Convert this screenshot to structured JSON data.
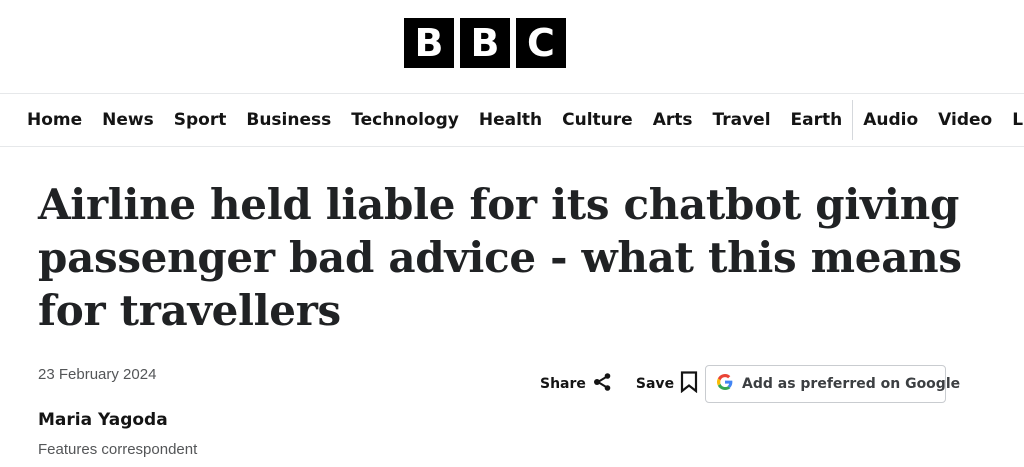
{
  "brand": {
    "letters": [
      "B",
      "B",
      "C"
    ]
  },
  "nav": {
    "items": [
      "Home",
      "News",
      "Sport",
      "Business",
      "Technology",
      "Health",
      "Culture",
      "Arts",
      "Travel",
      "Earth"
    ],
    "media_items": [
      "Audio",
      "Video",
      "Live"
    ]
  },
  "article": {
    "headline": "Airline held liable for its chatbot giving passenger bad advice - what this means for travellers",
    "date": "23 February 2024",
    "author": "Maria Yagoda",
    "role": "Features correspondent"
  },
  "actions": {
    "share_label": "Share",
    "share_icon": "share-icon",
    "save_label": "Save",
    "save_icon": "bookmark-icon",
    "google_label": "Add as preferred on Google",
    "google_icon": "google-g-icon"
  },
  "colors": {
    "text": "#141414",
    "muted": "#545658",
    "logo_bg": "#000000",
    "google_blue": "#4285F4",
    "google_red": "#EA4335",
    "google_yellow": "#FBBC05",
    "google_green": "#34A853"
  }
}
